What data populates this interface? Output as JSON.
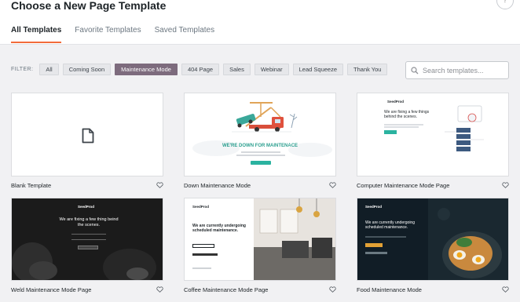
{
  "header": {
    "title": "Choose a New Page Template"
  },
  "tabs": [
    {
      "label": "All Templates",
      "active": true
    },
    {
      "label": "Favorite Templates",
      "active": false
    },
    {
      "label": "Saved Templates",
      "active": false
    }
  ],
  "filter": {
    "label": "FILTER:",
    "chips": [
      {
        "label": "All",
        "active": false
      },
      {
        "label": "Coming Soon",
        "active": false
      },
      {
        "label": "Maintenance Mode",
        "active": true
      },
      {
        "label": "404 Page",
        "active": false
      },
      {
        "label": "Sales",
        "active": false
      },
      {
        "label": "Webinar",
        "active": false
      },
      {
        "label": "Lead Squeeze",
        "active": false
      },
      {
        "label": "Thank You",
        "active": false
      }
    ]
  },
  "search": {
    "placeholder": "Search templates..."
  },
  "templates": [
    {
      "name": "Blank Template"
    },
    {
      "name": "Down Maintenance Mode",
      "preview": {
        "heading": "WE'RE DOWN FOR MAINTENACE"
      }
    },
    {
      "name": "Computer Maintenance Mode Page",
      "preview": {
        "logo": "SeedProd",
        "heading": "We are fixing a few things behind the scenes."
      }
    },
    {
      "name": "Weld Maintenance Mode Page",
      "preview": {
        "logo": "SeedProd",
        "heading": "We are fixing a few thing beind the scenes."
      }
    },
    {
      "name": "Coffee Maintenance Mode Page",
      "preview": {
        "logo": "SeedProd",
        "heading": "We are currently undergoing scheduled maintenance."
      }
    },
    {
      "name": "Food Maintenance Mode",
      "preview": {
        "logo": "SeedProd",
        "heading": "We are currently undergoing scheduled maintenance."
      }
    }
  ],
  "colors": {
    "accent": "#f26b3a",
    "active_chip": "#7d6b7d",
    "teal": "#2bb3a0"
  }
}
